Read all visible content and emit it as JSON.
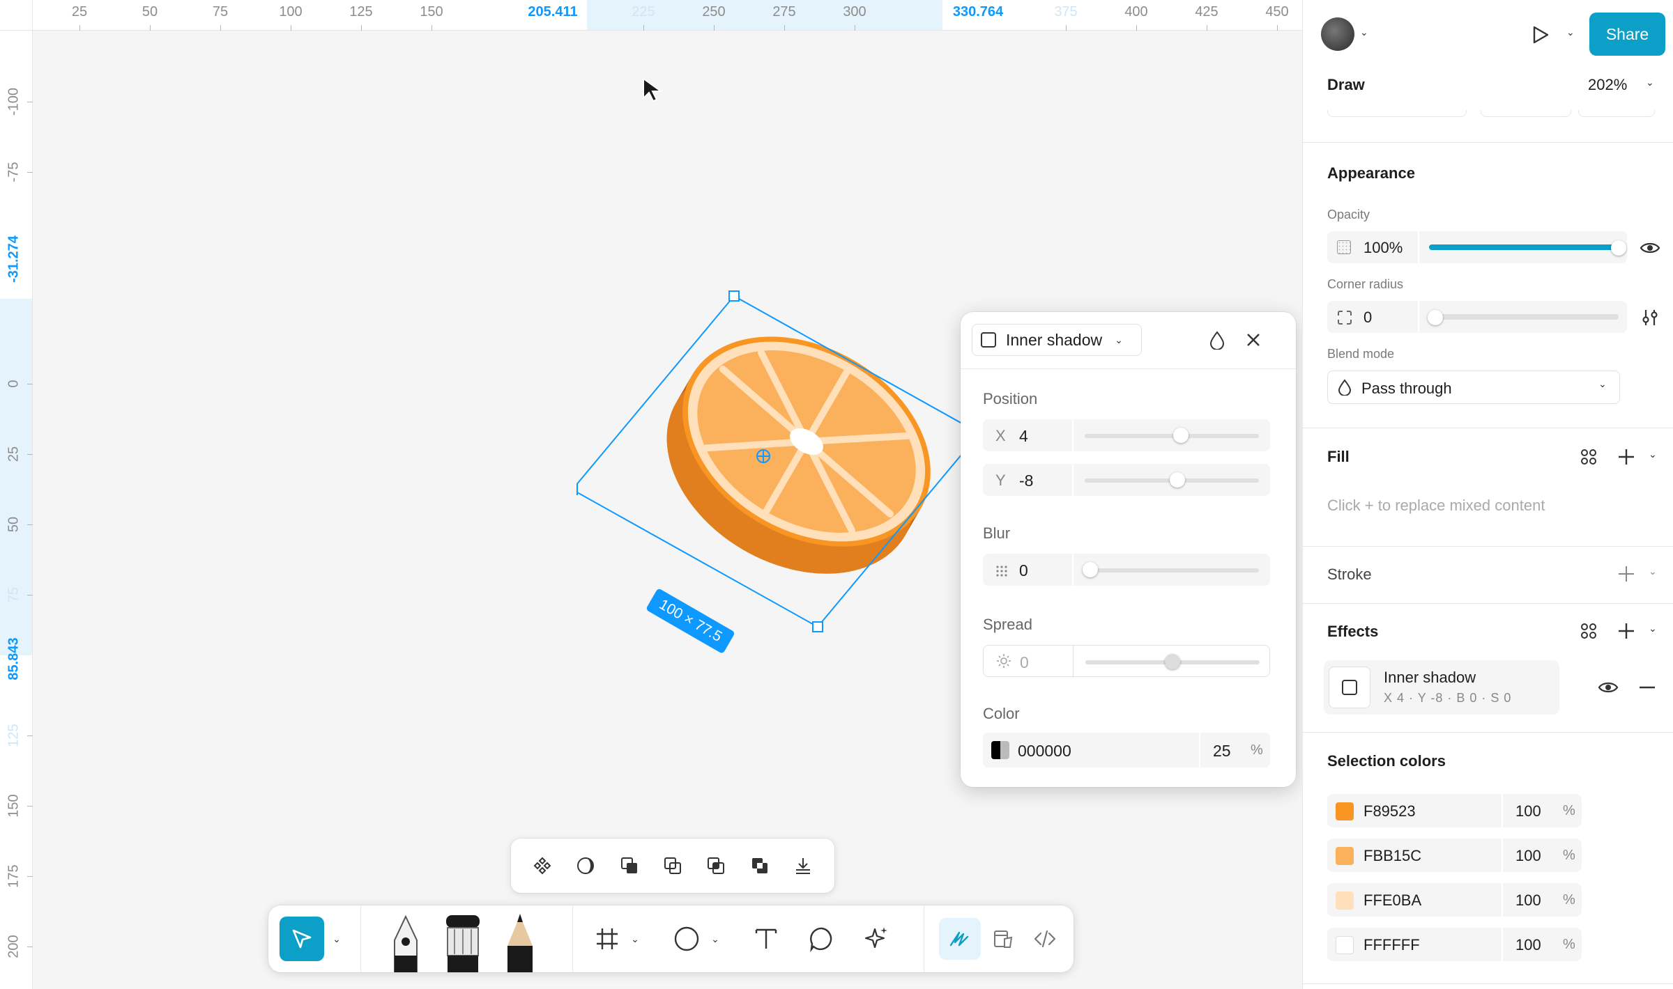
{
  "rulers": {
    "top": [
      "25",
      "50",
      "75",
      "100",
      "125",
      "150",
      "205.411",
      "225",
      "250",
      "275",
      "300",
      "330.764",
      "375",
      "400",
      "425",
      "450"
    ],
    "left": [
      "-100",
      "-75",
      "-31.274",
      "0",
      "25",
      "50",
      "75",
      "85.843",
      "125",
      "150",
      "175",
      "200"
    ]
  },
  "canvas": {
    "selection_size_label": "100 × 77.5"
  },
  "shadow_panel": {
    "type": "Inner shadow",
    "position_label": "Position",
    "x_label": "X",
    "x_value": "4",
    "x_slider": 0.55,
    "y_label": "Y",
    "y_value": "-8",
    "y_slider": 0.53,
    "blur_label": "Blur",
    "blur_value": "0",
    "blur_slider": 0.03,
    "spread_label": "Spread",
    "spread_value": "0",
    "spread_slider": 0.5,
    "color_label": "Color",
    "color_hex": "000000",
    "color_opacity": "25",
    "color_pct": "%"
  },
  "right_panel": {
    "share_label": "Share",
    "mode_label": "Draw",
    "zoom": "202%",
    "appearance": {
      "title": "Appearance",
      "opacity_label": "Opacity",
      "opacity_value": "100%",
      "opacity_fraction": 1.0,
      "corner_radius_label": "Corner radius",
      "corner_radius_value": "0",
      "blend_mode_label": "Blend mode",
      "blend_mode_value": "Pass through"
    },
    "fill": {
      "title": "Fill",
      "placeholder": "Click + to replace mixed content"
    },
    "stroke": {
      "title": "Stroke"
    },
    "effects": {
      "title": "Effects",
      "item_name": "Inner shadow",
      "item_detail": "X 4 · Y -8 · B 0 · S 0"
    },
    "selection_colors": {
      "title": "Selection colors",
      "items": [
        {
          "hex": "F89523",
          "opacity": "100",
          "pct": "%",
          "color": "#F89523"
        },
        {
          "hex": "FBB15C",
          "opacity": "100",
          "pct": "%",
          "color": "#FBB15C"
        },
        {
          "hex": "FFE0BA",
          "opacity": "100",
          "pct": "%",
          "color": "#FFE0BA"
        },
        {
          "hex": "FFFFFF",
          "opacity": "100",
          "pct": "%",
          "color": "#FFFFFF"
        }
      ]
    }
  },
  "colors": {
    "accent": "#0d99ff",
    "share": "#0c9fc7",
    "orange_dark": "#b96a1c",
    "orange": "#f89523",
    "orange_light": "#fbb15c",
    "rind": "#ffe0ba"
  }
}
